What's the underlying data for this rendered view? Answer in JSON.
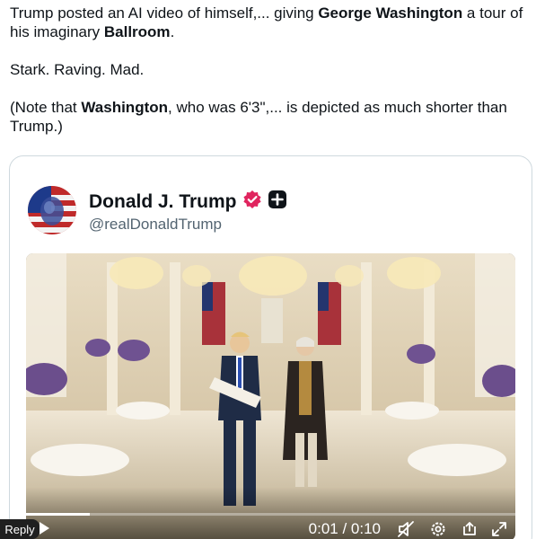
{
  "post": {
    "line1": [
      {
        "text": "Trump posted an AI video of himself,... giving ",
        "bold": false
      },
      {
        "text": "George Washington",
        "bold": true
      },
      {
        "text": " a tour of his imaginary ",
        "bold": false
      },
      {
        "text": "Ballroom",
        "bold": true
      },
      {
        "text": ".",
        "bold": false
      }
    ],
    "line2": "Stark. Raving. Mad.",
    "line3": [
      {
        "text": "(Note that ",
        "bold": false
      },
      {
        "text": "Washington",
        "bold": true
      },
      {
        "text": ", who was 6'3\",... is depicted as much shorter than Trump.)",
        "bold": false
      }
    ]
  },
  "quoted": {
    "name": "Donald J. Trump",
    "handle": "@realDonaldTrump",
    "verified_color": "#e0245e",
    "avatar_icon": "flag-portrait-avatar"
  },
  "video": {
    "time": "0:01 / 0:10",
    "progress_fraction": 0.13,
    "icons": [
      "play-icon",
      "mute-icon",
      "settings-icon",
      "share-icon",
      "fullscreen-icon"
    ]
  },
  "footer": {
    "reply_label": "Reply"
  }
}
